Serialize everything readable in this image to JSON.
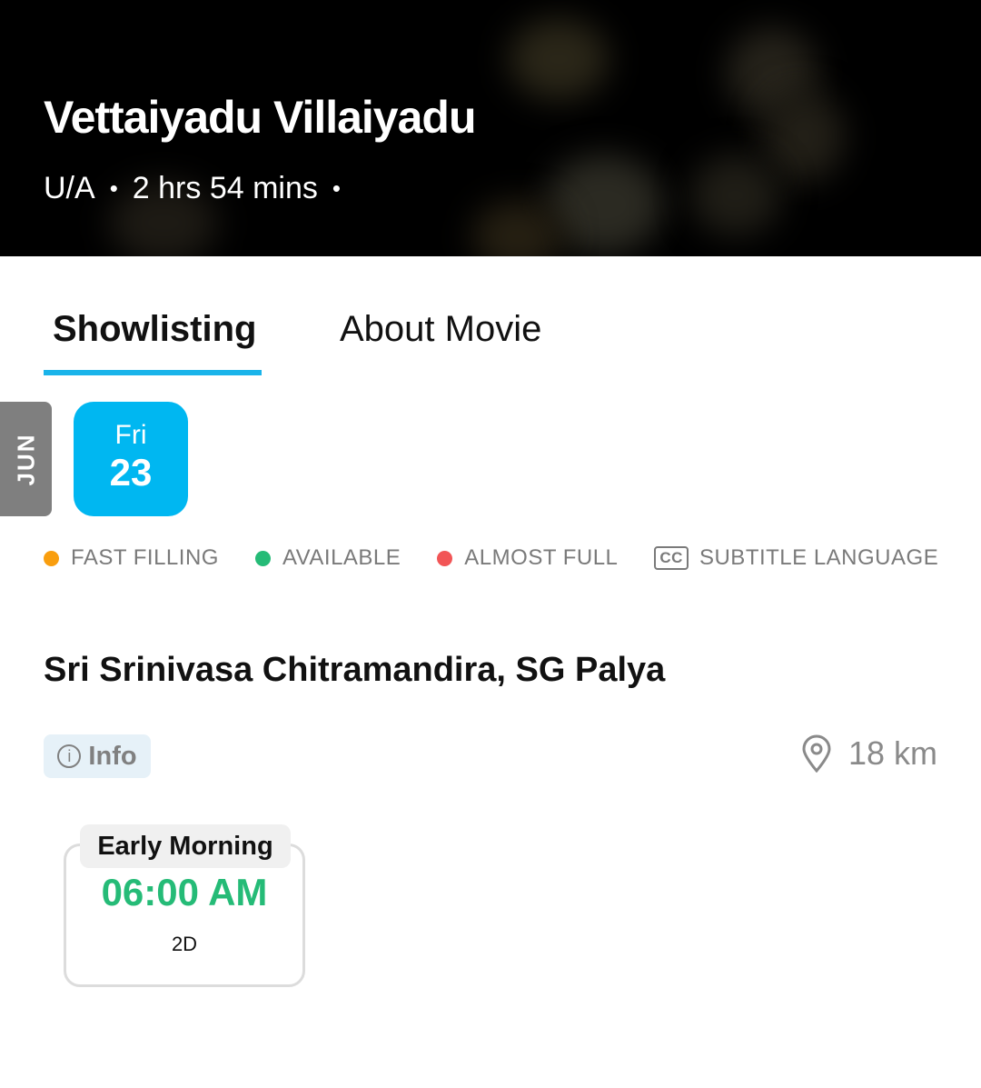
{
  "movie": {
    "title": "Vettaiyadu Villaiyadu",
    "certificate": "U/A",
    "duration": "2 hrs 54 mins",
    "separator": "•"
  },
  "tabs": [
    {
      "label": "Showlisting",
      "active": true
    },
    {
      "label": "About Movie",
      "active": false
    }
  ],
  "dates": {
    "month": "JUN",
    "selected": {
      "day": "Fri",
      "date": "23"
    }
  },
  "legend": [
    {
      "label": "FAST FILLING",
      "color": "#f99e0e",
      "icon": "orange-dot"
    },
    {
      "label": "AVAILABLE",
      "color": "#25bb77",
      "icon": "green-dot"
    },
    {
      "label": "ALMOST FULL",
      "color": "#f25556",
      "icon": "red-dot"
    },
    {
      "label": "SUBTITLE LANGUAGE",
      "icon": "cc-icon",
      "icon_text": "CC"
    }
  ],
  "theatre": {
    "name": "Sri Srinivasa Chitramandira, SG Palya",
    "info_label": "Info",
    "info_icon_text": "i",
    "distance": "18 km",
    "shows": [
      {
        "slot": "Early Morning",
        "time": "06:00 AM",
        "format": "2D",
        "status_color": "#25bb77"
      }
    ]
  }
}
